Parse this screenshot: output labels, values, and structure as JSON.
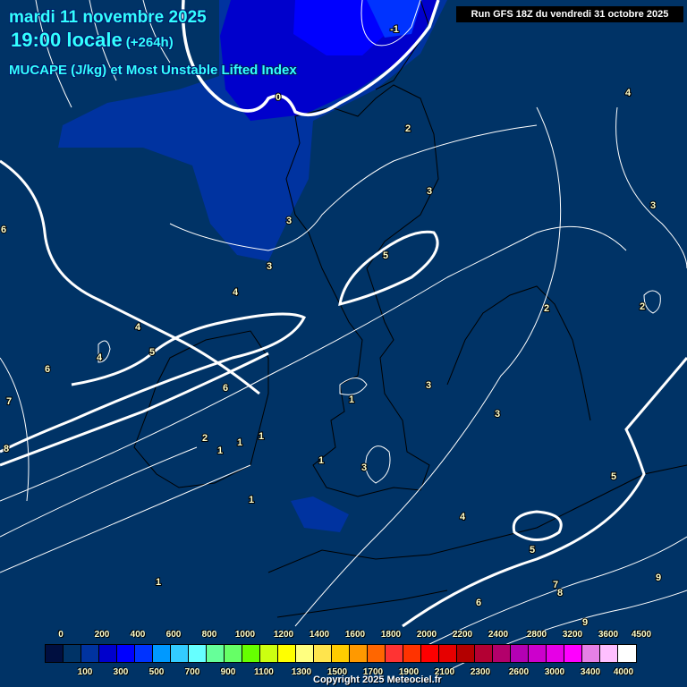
{
  "header": {
    "date": "mardi 11 novembre 2025",
    "time": "19:00 locale",
    "lead": "(+264h)",
    "parameter": "MUCAPE (J/kg) et Most Unstable Lifted Index",
    "run": "Run GFS 18Z du vendredi 31 octobre 2025"
  },
  "colors": {
    "background": "#003366",
    "shade1": "#0033a0",
    "shade2": "#0000cc",
    "shade3": "#0000ff",
    "shade4": "#0033ff",
    "header_text": "#33ffff"
  },
  "legend": {
    "colors": [
      "#000f40",
      "#003366",
      "#0033a0",
      "#0000cc",
      "#0000ff",
      "#0033ff",
      "#0099ff",
      "#33ccff",
      "#66ffff",
      "#66ff99",
      "#66ff66",
      "#66ff00",
      "#ccff11",
      "#ffff00",
      "#ffff80",
      "#ffe44d",
      "#ffcc00",
      "#ff9900",
      "#ff6600",
      "#ff3333",
      "#ff3300",
      "#ff0000",
      "#e60000",
      "#b30000",
      "#b30033",
      "#b3006b",
      "#b300b3",
      "#cc00cc",
      "#e600e6",
      "#ff00ff",
      "#e680e6",
      "#ffbfff",
      "#ffffff"
    ],
    "top_labels": [
      "0",
      "200",
      "400",
      "600",
      "800",
      "1000",
      "1200",
      "1400",
      "1600",
      "1800",
      "2000",
      "2200",
      "2400",
      "2800",
      "3200",
      "3600",
      "4500"
    ],
    "bottom_labels": [
      "100",
      "300",
      "500",
      "700",
      "900",
      "1100",
      "1300",
      "1500",
      "1700",
      "1900",
      "2100",
      "2300",
      "2600",
      "3000",
      "3400",
      "4000"
    ]
  },
  "contour_labels": [
    "-1",
    "0",
    "2",
    "4",
    "3",
    "3",
    "3",
    "3",
    "6",
    "5",
    "4",
    "4",
    "2",
    "2",
    "5",
    "4",
    "6",
    "6",
    "3",
    "1",
    "7",
    "3",
    "2",
    "1",
    "1",
    "1",
    "8",
    "1",
    "3",
    "5",
    "1",
    "4",
    "5",
    "1",
    "7",
    "8",
    "9",
    "6",
    "9"
  ],
  "copyright": "Copyright 2025 Meteociel.fr"
}
